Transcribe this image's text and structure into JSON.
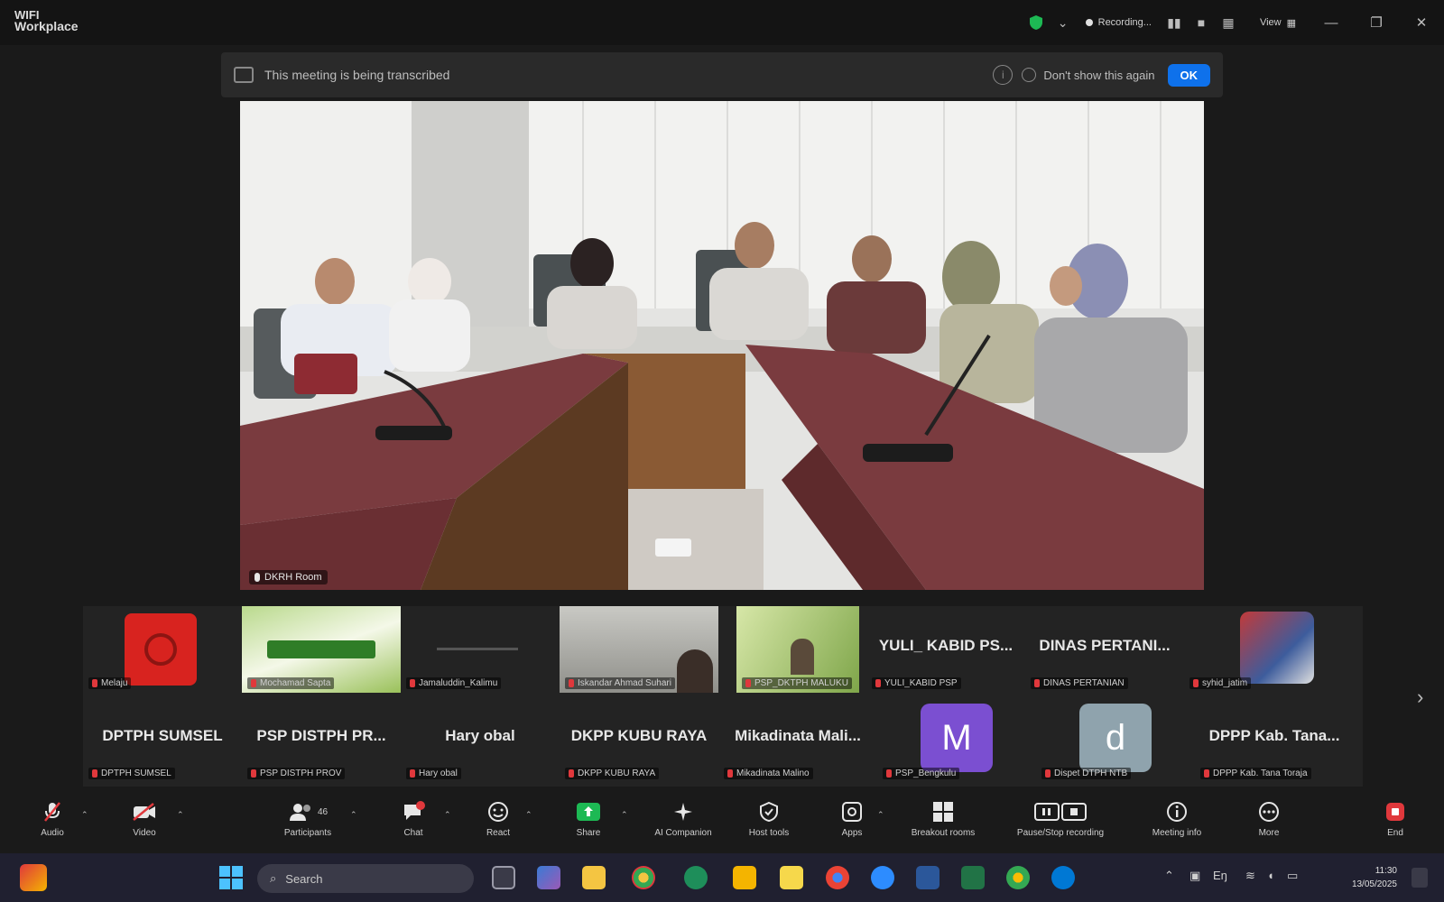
{
  "window": {
    "title_line1": "WIFI",
    "title_line2": "Workplace",
    "recording_label": "Recording...",
    "view_label": "View",
    "minimize_glyph": "—",
    "maximize_glyph": "❐",
    "close_glyph": "✕"
  },
  "banner": {
    "message": "This meeting is being transcribed",
    "dont_show_label": "Don't show this again",
    "ok_label": "OK"
  },
  "main_video": {
    "name": "DKRH Room"
  },
  "gallery": {
    "row1": [
      {
        "tile_name": "Melaju",
        "kind": "red-logo"
      },
      {
        "tile_name": "Mochamad Sapta",
        "kind": "green-banner"
      },
      {
        "tile_name": "Jamaluddin_Kalimu",
        "kind": "blank"
      },
      {
        "tile_name": "Iskandar Ahmad Suhari",
        "kind": "room"
      },
      {
        "tile_name": "PSP_DKTPH MALUKU",
        "kind": "plant"
      },
      {
        "tile_name": "YULI_KABID PSP",
        "big_name": "YULI_ KABID PS...",
        "kind": "name"
      },
      {
        "tile_name": "DINAS PERTANIAN",
        "big_name": "DINAS PERTANI...",
        "kind": "name"
      },
      {
        "tile_name": "syhid_jatim",
        "kind": "photo"
      }
    ],
    "row2": [
      {
        "tile_name": "DPTPH SUMSEL",
        "big_name": "DPTPH SUMSEL",
        "kind": "name"
      },
      {
        "tile_name": "PSP DISTPH PROV",
        "big_name": "PSP DISTPH PR...",
        "kind": "name"
      },
      {
        "tile_name": "Hary obal",
        "big_name": "Hary obal",
        "kind": "name"
      },
      {
        "tile_name": "DKPP KUBU RAYA",
        "big_name": "DKPP KUBU RAYA",
        "kind": "name"
      },
      {
        "tile_name": "Mikadinata Malino",
        "big_name": "Mikadinata Mali...",
        "kind": "name"
      },
      {
        "tile_name": "PSP_Bengkulu",
        "avatar_letter": "M",
        "avatar_color": "#7b4fd1",
        "kind": "avatar"
      },
      {
        "tile_name": "Dispet DTPH NTB",
        "avatar_letter": "d",
        "avatar_color": "#8fa3ad",
        "kind": "avatar"
      },
      {
        "tile_name": "DPPP Kab. Tana Toraja",
        "big_name": "DPPP Kab. Tana...",
        "kind": "name"
      }
    ],
    "next_glyph": "›"
  },
  "toolbar": {
    "items": [
      {
        "id": "audio",
        "label": "Audio"
      },
      {
        "id": "video",
        "label": "Video"
      },
      {
        "id": "participants",
        "label": "Participants",
        "count": "46"
      },
      {
        "id": "chat",
        "label": "Chat"
      },
      {
        "id": "react",
        "label": "React"
      },
      {
        "id": "share",
        "label": "Share"
      },
      {
        "id": "ai-companion",
        "label": "AI Companion"
      },
      {
        "id": "host-tools",
        "label": "Host tools"
      },
      {
        "id": "apps",
        "label": "Apps"
      },
      {
        "id": "breakout-rooms",
        "label": "Breakout rooms"
      },
      {
        "id": "recording",
        "label": "Pause/Stop recording"
      },
      {
        "id": "meeting-info",
        "label": "Meeting info"
      },
      {
        "id": "more",
        "label": "More"
      },
      {
        "id": "end",
        "label": "End"
      }
    ],
    "colors": {
      "accent": "#0e71eb",
      "danger": "#e0383c",
      "share": "#1db954"
    }
  },
  "taskbar": {
    "search_placeholder": "Search",
    "time": "11:30",
    "date": "13/05/2025"
  }
}
